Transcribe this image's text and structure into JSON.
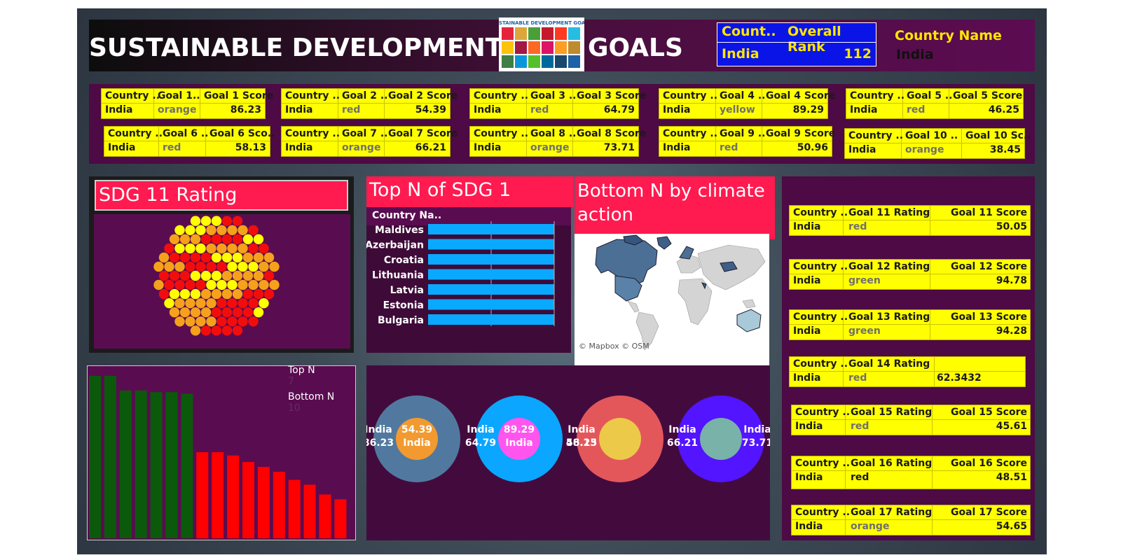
{
  "header": {
    "title_left": "SUSTAINABLE DEVELOPMENT",
    "title_right": "GOALS",
    "logo_text": "SUSTAINABLE DEVELOPMENT GOALS",
    "rank_col1": "Count..",
    "rank_col2": "Overall Rank",
    "rank_country": "India",
    "rank_value": "112",
    "country_name_label": "Country Name",
    "country_name_value": "India"
  },
  "goal_cards": [
    {
      "h1": "Country ..",
      "h2": "Goal 1..",
      "h3": "Goal 1 Score",
      "country": "India",
      "rating": "orange",
      "score": "86.23"
    },
    {
      "h1": "Country ..",
      "h2": "Goal 2 ..",
      "h3": "Goal 2 Score",
      "country": "India",
      "rating": "red",
      "score": "54.39"
    },
    {
      "h1": "Country ..",
      "h2": "Goal 3 ..",
      "h3": "Goal 3 Score",
      "country": "India",
      "rating": "red",
      "score": "64.79"
    },
    {
      "h1": "Country ..",
      "h2": "Goal 4 ..",
      "h3": "Goal 4 Score",
      "country": "India",
      "rating": "yellow",
      "score": "89.29"
    },
    {
      "h1": "Country ..",
      "h2": "Goal 5 ..",
      "h3": "Goal 5 Score",
      "country": "India",
      "rating": "red",
      "score": "46.25"
    },
    {
      "h1": "Country ..",
      "h2": "Goal 6 ..",
      "h3": "Goal 6 Sco..",
      "country": "India",
      "rating": "red",
      "score": "58.13"
    },
    {
      "h1": "Country ..",
      "h2": "Goal 7 ..",
      "h3": "Goal 7 Score",
      "country": "India",
      "rating": "orange",
      "score": "66.21"
    },
    {
      "h1": "Country ..",
      "h2": "Goal 8 ..",
      "h3": "Goal 8 Score",
      "country": "India",
      "rating": "orange",
      "score": "73.71"
    },
    {
      "h1": "Country ..",
      "h2": "Goal 9 ..",
      "h3": "Goal 9 Score",
      "country": "India",
      "rating": "red",
      "score": "50.96"
    },
    {
      "h1": "Country ..",
      "h2": "Goal 10 ..",
      "h3": "Goal 10 Sc..",
      "country": "India",
      "rating": "orange",
      "score": "38.45"
    }
  ],
  "sdg11": {
    "title": "SDG 11 Rating",
    "colors": {
      "yellow": "#ffff00",
      "orange": "#f5a11b",
      "red": "#f20d0d"
    }
  },
  "topn": {
    "title": "Top N of SDG 1",
    "column_header": "Country Na..",
    "bar_color": "#09a9ff"
  },
  "map": {
    "title": "Bottom N by climate action",
    "credit": "© Mapbox © OSM"
  },
  "parameters": {
    "top_label": "Top N",
    "top_value": "7",
    "bottom_label": "Bottom N",
    "bottom_value": "10"
  },
  "donuts": [
    {
      "outer_color": "#51799f",
      "inner_color": "#f29a2f",
      "outer_country": "India",
      "outer_value": "86.23",
      "inner_value": "54.39",
      "inner_country": "India"
    },
    {
      "outer_color": "#0aa6ff",
      "inner_color": "#ff55ee",
      "outer_country": "India",
      "outer_value": "64.79",
      "inner_value": "89.29",
      "inner_country": "India"
    },
    {
      "outer_color": "#e3575b",
      "inner_color": "#edc94a",
      "outer_country": "India",
      "outer_value": "58.13",
      "inner_value": "46.25",
      "inner_country": ""
    },
    {
      "outer_color": "#5314ff",
      "inner_color": "#78b2a8",
      "outer_country": "India",
      "outer_value": "66.21",
      "inner_value": "73.71",
      "inner_country": "India"
    }
  ],
  "right_cards": [
    {
      "h1": "Country ..",
      "h2": "Goal 11 Rating",
      "h3": "Goal 11 Score",
      "country": "India",
      "rating": "red",
      "score": "50.05"
    },
    {
      "h1": "Country ..",
      "h2": "Goal 12 Rating",
      "h3": "Goal 12 Score",
      "country": "India",
      "rating": "green",
      "score": "94.78"
    },
    {
      "h1": "Country ..",
      "h2": "Goal 13 Rating",
      "h3": "Goal 13 Score",
      "country": "India",
      "rating": "green",
      "score": "94.28"
    },
    {
      "h1": "Country ..",
      "h2": "Goal 14 Rating",
      "h3": "",
      "country": "India",
      "rating": "red",
      "score": "62.3432"
    },
    {
      "h1": "Country ..",
      "h2": "Goal 15 Rating",
      "h3": "Goal 15 Score",
      "country": "India",
      "rating": "red",
      "score": "45.61"
    },
    {
      "h1": "Country ..",
      "h2": "Goal 16 Rating",
      "h3": "Goal 16 Score",
      "country": "India",
      "rating": "red",
      "score": "48.51"
    },
    {
      "h1": "Country ..",
      "h2": "Goal 17 Rating",
      "h3": "Goal 17 Score",
      "country": "India",
      "rating": "orange",
      "score": "54.65"
    }
  ],
  "chart_data": [
    {
      "type": "bar",
      "title": "Top N of SDG 1",
      "categories": [
        "Maldives",
        "Azerbaijan",
        "Croatia",
        "Lithuania",
        "Latvia",
        "Estonia",
        "Bulgaria"
      ],
      "values": [
        100,
        100,
        100,
        100,
        100,
        100,
        100
      ],
      "orientation": "horizontal"
    },
    {
      "type": "bar",
      "categories": [],
      "series": [
        {
          "color": "#0b5a0b",
          "values": [
            100,
            100,
            91,
            91,
            90,
            90,
            89
          ]
        },
        {
          "color": "#ff0000",
          "values": [
            53,
            53,
            51,
            47,
            44,
            41,
            36,
            33,
            27,
            24
          ]
        }
      ],
      "ylim": [
        0,
        100
      ]
    }
  ]
}
